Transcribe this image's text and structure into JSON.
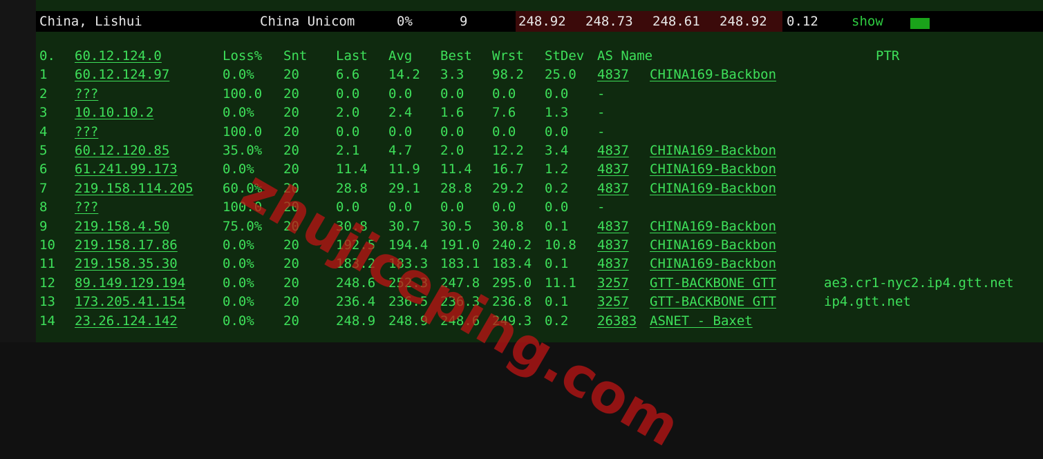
{
  "summary": {
    "location": "China, Lishui",
    "provider": "China Unicom",
    "loss": "0%",
    "sent": "9",
    "last": "248.92",
    "avg": "248.73",
    "best": "248.61",
    "worst": "248.92",
    "stdev": "0.12",
    "show_label": "show",
    "colors": {
      "red_cell": "#3b0a0a",
      "accent": "#2ecc40"
    }
  },
  "mtr": {
    "headers": {
      "hop": "0.",
      "host": "60.12.124.0",
      "loss": "Loss%",
      "snt": "Snt",
      "last": "Last",
      "avg": "Avg",
      "best": "Best",
      "wrst": "Wrst",
      "stdev": "StDev",
      "asname": "AS Name",
      "ptr": "PTR"
    },
    "rows": [
      {
        "hop": "1",
        "host": "60.12.124.97",
        "loss": "0.0%",
        "snt": "20",
        "last": "6.6",
        "avg": "14.2",
        "best": "3.3",
        "wrst": "98.2",
        "stdev": "25.0",
        "as": "4837",
        "asname": "CHINA169-Backbon",
        "ptr": ""
      },
      {
        "hop": "2",
        "host": "???",
        "loss": "100.0",
        "snt": "20",
        "last": "0.0",
        "avg": "0.0",
        "best": "0.0",
        "wrst": "0.0",
        "stdev": "0.0",
        "as": "-",
        "asname": "",
        "ptr": ""
      },
      {
        "hop": "3",
        "host": "10.10.10.2",
        "loss": "0.0%",
        "snt": "20",
        "last": "2.0",
        "avg": "2.4",
        "best": "1.6",
        "wrst": "7.6",
        "stdev": "1.3",
        "as": "-",
        "asname": "",
        "ptr": ""
      },
      {
        "hop": "4",
        "host": "???",
        "loss": "100.0",
        "snt": "20",
        "last": "0.0",
        "avg": "0.0",
        "best": "0.0",
        "wrst": "0.0",
        "stdev": "0.0",
        "as": "-",
        "asname": "",
        "ptr": ""
      },
      {
        "hop": "5",
        "host": "60.12.120.85",
        "loss": "35.0%",
        "snt": "20",
        "last": "2.1",
        "avg": "4.7",
        "best": "2.0",
        "wrst": "12.2",
        "stdev": "3.4",
        "as": "4837",
        "asname": "CHINA169-Backbon",
        "ptr": ""
      },
      {
        "hop": "6",
        "host": "61.241.99.173",
        "loss": "0.0%",
        "snt": "20",
        "last": "11.4",
        "avg": "11.9",
        "best": "11.4",
        "wrst": "16.7",
        "stdev": "1.2",
        "as": "4837",
        "asname": "CHINA169-Backbon",
        "ptr": ""
      },
      {
        "hop": "7",
        "host": "219.158.114.205",
        "loss": "60.0%",
        "snt": "20",
        "last": "28.8",
        "avg": "29.1",
        "best": "28.8",
        "wrst": "29.2",
        "stdev": "0.2",
        "as": "4837",
        "asname": "CHINA169-Backbon",
        "ptr": ""
      },
      {
        "hop": "8",
        "host": "???",
        "loss": "100.0",
        "snt": "20",
        "last": "0.0",
        "avg": "0.0",
        "best": "0.0",
        "wrst": "0.0",
        "stdev": "0.0",
        "as": "-",
        "asname": "",
        "ptr": ""
      },
      {
        "hop": "9",
        "host": "219.158.4.50",
        "loss": "75.0%",
        "snt": "20",
        "last": "30.8",
        "avg": "30.7",
        "best": "30.5",
        "wrst": "30.8",
        "stdev": "0.1",
        "as": "4837",
        "asname": "CHINA169-Backbon",
        "ptr": ""
      },
      {
        "hop": "10",
        "host": "219.158.17.86",
        "loss": "0.0%",
        "snt": "20",
        "last": "192.5",
        "avg": "194.4",
        "best": "191.0",
        "wrst": "240.2",
        "stdev": "10.8",
        "as": "4837",
        "asname": "CHINA169-Backbon",
        "ptr": ""
      },
      {
        "hop": "11",
        "host": "219.158.35.30",
        "loss": "0.0%",
        "snt": "20",
        "last": "183.2",
        "avg": "183.3",
        "best": "183.1",
        "wrst": "183.4",
        "stdev": "0.1",
        "as": "4837",
        "asname": "CHINA169-Backbon",
        "ptr": ""
      },
      {
        "hop": "12",
        "host": "89.149.129.194",
        "loss": "0.0%",
        "snt": "20",
        "last": "248.6",
        "avg": "252.3",
        "best": "247.8",
        "wrst": "295.0",
        "stdev": "11.1",
        "as": "3257",
        "asname": "GTT-BACKBONE GTT",
        "ptr": "ae3.cr1-nyc2.ip4.gtt.net"
      },
      {
        "hop": "13",
        "host": "173.205.41.154",
        "loss": "0.0%",
        "snt": "20",
        "last": "236.4",
        "avg": "236.5",
        "best": "236.3",
        "wrst": "236.8",
        "stdev": "0.1",
        "as": "3257",
        "asname": "GTT-BACKBONE GTT",
        "ptr": "ip4.gtt.net"
      },
      {
        "hop": "14",
        "host": "23.26.124.142",
        "loss": "0.0%",
        "snt": "20",
        "last": "248.9",
        "avg": "248.9",
        "best": "248.6",
        "wrst": "249.3",
        "stdev": "0.2",
        "as": "26383",
        "asname": "ASNET - Baxet",
        "ptr": ""
      }
    ],
    "colors": {
      "text": "#3ee05a",
      "background": "#0f2a0f"
    }
  },
  "watermark": "zhujiceping.com"
}
